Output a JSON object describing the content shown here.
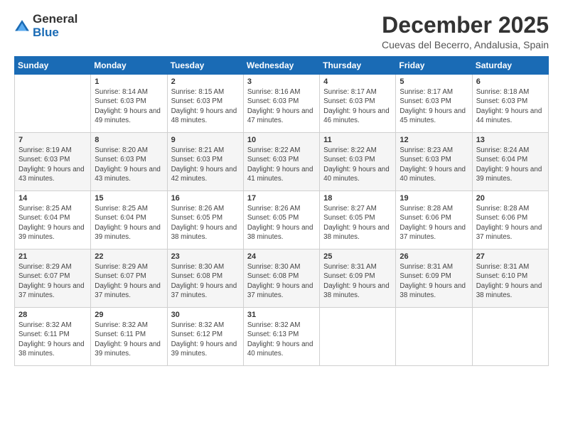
{
  "logo": {
    "general": "General",
    "blue": "Blue"
  },
  "title": "December 2025",
  "location": "Cuevas del Becerro, Andalusia, Spain",
  "days_of_week": [
    "Sunday",
    "Monday",
    "Tuesday",
    "Wednesday",
    "Thursday",
    "Friday",
    "Saturday"
  ],
  "weeks": [
    [
      {
        "day": "",
        "sunrise": "",
        "sunset": "",
        "daylight": ""
      },
      {
        "day": "1",
        "sunrise": "Sunrise: 8:14 AM",
        "sunset": "Sunset: 6:03 PM",
        "daylight": "Daylight: 9 hours and 49 minutes."
      },
      {
        "day": "2",
        "sunrise": "Sunrise: 8:15 AM",
        "sunset": "Sunset: 6:03 PM",
        "daylight": "Daylight: 9 hours and 48 minutes."
      },
      {
        "day": "3",
        "sunrise": "Sunrise: 8:16 AM",
        "sunset": "Sunset: 6:03 PM",
        "daylight": "Daylight: 9 hours and 47 minutes."
      },
      {
        "day": "4",
        "sunrise": "Sunrise: 8:17 AM",
        "sunset": "Sunset: 6:03 PM",
        "daylight": "Daylight: 9 hours and 46 minutes."
      },
      {
        "day": "5",
        "sunrise": "Sunrise: 8:17 AM",
        "sunset": "Sunset: 6:03 PM",
        "daylight": "Daylight: 9 hours and 45 minutes."
      },
      {
        "day": "6",
        "sunrise": "Sunrise: 8:18 AM",
        "sunset": "Sunset: 6:03 PM",
        "daylight": "Daylight: 9 hours and 44 minutes."
      }
    ],
    [
      {
        "day": "7",
        "sunrise": "Sunrise: 8:19 AM",
        "sunset": "Sunset: 6:03 PM",
        "daylight": "Daylight: 9 hours and 43 minutes."
      },
      {
        "day": "8",
        "sunrise": "Sunrise: 8:20 AM",
        "sunset": "Sunset: 6:03 PM",
        "daylight": "Daylight: 9 hours and 43 minutes."
      },
      {
        "day": "9",
        "sunrise": "Sunrise: 8:21 AM",
        "sunset": "Sunset: 6:03 PM",
        "daylight": "Daylight: 9 hours and 42 minutes."
      },
      {
        "day": "10",
        "sunrise": "Sunrise: 8:22 AM",
        "sunset": "Sunset: 6:03 PM",
        "daylight": "Daylight: 9 hours and 41 minutes."
      },
      {
        "day": "11",
        "sunrise": "Sunrise: 8:22 AM",
        "sunset": "Sunset: 6:03 PM",
        "daylight": "Daylight: 9 hours and 40 minutes."
      },
      {
        "day": "12",
        "sunrise": "Sunrise: 8:23 AM",
        "sunset": "Sunset: 6:03 PM",
        "daylight": "Daylight: 9 hours and 40 minutes."
      },
      {
        "day": "13",
        "sunrise": "Sunrise: 8:24 AM",
        "sunset": "Sunset: 6:04 PM",
        "daylight": "Daylight: 9 hours and 39 minutes."
      }
    ],
    [
      {
        "day": "14",
        "sunrise": "Sunrise: 8:25 AM",
        "sunset": "Sunset: 6:04 PM",
        "daylight": "Daylight: 9 hours and 39 minutes."
      },
      {
        "day": "15",
        "sunrise": "Sunrise: 8:25 AM",
        "sunset": "Sunset: 6:04 PM",
        "daylight": "Daylight: 9 hours and 39 minutes."
      },
      {
        "day": "16",
        "sunrise": "Sunrise: 8:26 AM",
        "sunset": "Sunset: 6:05 PM",
        "daylight": "Daylight: 9 hours and 38 minutes."
      },
      {
        "day": "17",
        "sunrise": "Sunrise: 8:26 AM",
        "sunset": "Sunset: 6:05 PM",
        "daylight": "Daylight: 9 hours and 38 minutes."
      },
      {
        "day": "18",
        "sunrise": "Sunrise: 8:27 AM",
        "sunset": "Sunset: 6:05 PM",
        "daylight": "Daylight: 9 hours and 38 minutes."
      },
      {
        "day": "19",
        "sunrise": "Sunrise: 8:28 AM",
        "sunset": "Sunset: 6:06 PM",
        "daylight": "Daylight: 9 hours and 37 minutes."
      },
      {
        "day": "20",
        "sunrise": "Sunrise: 8:28 AM",
        "sunset": "Sunset: 6:06 PM",
        "daylight": "Daylight: 9 hours and 37 minutes."
      }
    ],
    [
      {
        "day": "21",
        "sunrise": "Sunrise: 8:29 AM",
        "sunset": "Sunset: 6:07 PM",
        "daylight": "Daylight: 9 hours and 37 minutes."
      },
      {
        "day": "22",
        "sunrise": "Sunrise: 8:29 AM",
        "sunset": "Sunset: 6:07 PM",
        "daylight": "Daylight: 9 hours and 37 minutes."
      },
      {
        "day": "23",
        "sunrise": "Sunrise: 8:30 AM",
        "sunset": "Sunset: 6:08 PM",
        "daylight": "Daylight: 9 hours and 37 minutes."
      },
      {
        "day": "24",
        "sunrise": "Sunrise: 8:30 AM",
        "sunset": "Sunset: 6:08 PM",
        "daylight": "Daylight: 9 hours and 37 minutes."
      },
      {
        "day": "25",
        "sunrise": "Sunrise: 8:31 AM",
        "sunset": "Sunset: 6:09 PM",
        "daylight": "Daylight: 9 hours and 38 minutes."
      },
      {
        "day": "26",
        "sunrise": "Sunrise: 8:31 AM",
        "sunset": "Sunset: 6:09 PM",
        "daylight": "Daylight: 9 hours and 38 minutes."
      },
      {
        "day": "27",
        "sunrise": "Sunrise: 8:31 AM",
        "sunset": "Sunset: 6:10 PM",
        "daylight": "Daylight: 9 hours and 38 minutes."
      }
    ],
    [
      {
        "day": "28",
        "sunrise": "Sunrise: 8:32 AM",
        "sunset": "Sunset: 6:11 PM",
        "daylight": "Daylight: 9 hours and 38 minutes."
      },
      {
        "day": "29",
        "sunrise": "Sunrise: 8:32 AM",
        "sunset": "Sunset: 6:11 PM",
        "daylight": "Daylight: 9 hours and 39 minutes."
      },
      {
        "day": "30",
        "sunrise": "Sunrise: 8:32 AM",
        "sunset": "Sunset: 6:12 PM",
        "daylight": "Daylight: 9 hours and 39 minutes."
      },
      {
        "day": "31",
        "sunrise": "Sunrise: 8:32 AM",
        "sunset": "Sunset: 6:13 PM",
        "daylight": "Daylight: 9 hours and 40 minutes."
      },
      {
        "day": "",
        "sunrise": "",
        "sunset": "",
        "daylight": ""
      },
      {
        "day": "",
        "sunrise": "",
        "sunset": "",
        "daylight": ""
      },
      {
        "day": "",
        "sunrise": "",
        "sunset": "",
        "daylight": ""
      }
    ]
  ]
}
